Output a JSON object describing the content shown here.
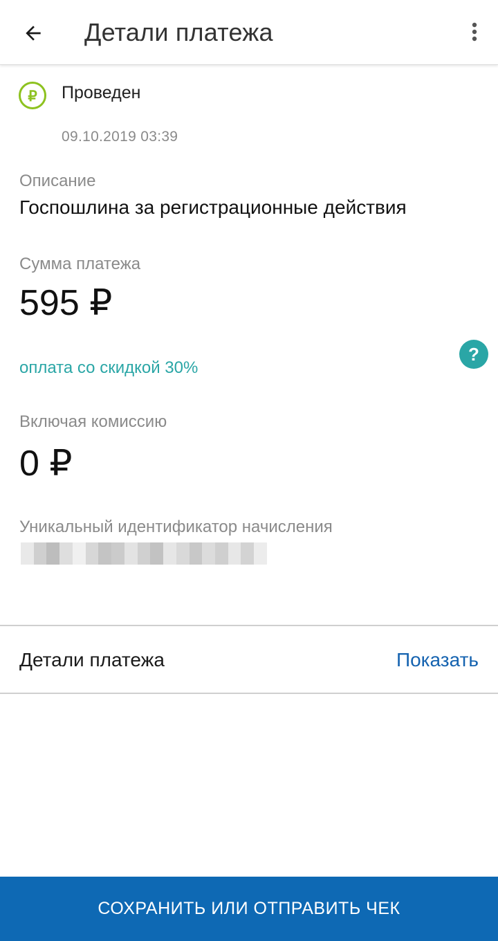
{
  "header": {
    "title": "Детали платежа",
    "back_icon": "arrow-left-icon",
    "menu_icon": "more-vertical-icon"
  },
  "status": {
    "icon": "ruble-circle-icon",
    "text": "Проведен",
    "datetime": "09.10.2019 03:39",
    "icon_color": "#8dc21f"
  },
  "description": {
    "label": "Описание",
    "value": "Госпошлина за регистрационные действия"
  },
  "amount": {
    "label": "Сумма платежа",
    "value": "595 ₽"
  },
  "discount": {
    "text": "оплата со скидкой 30%",
    "color": "#2aa6a6",
    "help_icon": "question-circle-icon"
  },
  "commission": {
    "label": "Включая комиссию",
    "value": "0 ₽"
  },
  "accrual_id": {
    "label": "Уникальный идентификатор начисления"
  },
  "details": {
    "label": "Детали платежа",
    "action": "Показать",
    "action_color": "#1563b0"
  },
  "footer": {
    "button_label": "СОХРАНИТЬ ИЛИ ОТПРАВИТЬ ЧЕК",
    "button_color": "#0e69b4"
  }
}
